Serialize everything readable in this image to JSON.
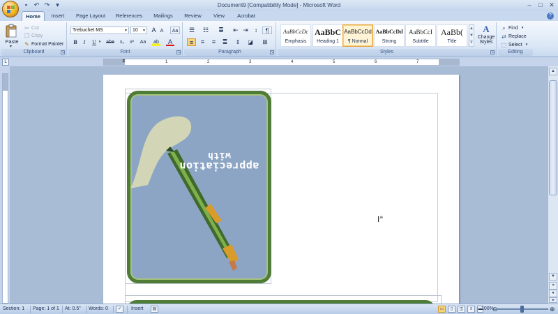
{
  "window": {
    "title": "Document9 [Compatibility Mode] - Microsoft Word",
    "controls": [
      "minimize",
      "maximize",
      "close"
    ]
  },
  "quick_access": [
    "save-icon",
    "undo-icon",
    "redo-icon",
    "customize-icon"
  ],
  "tabs": [
    "Home",
    "Insert",
    "Page Layout",
    "References",
    "Mailings",
    "Review",
    "View",
    "Acrobat"
  ],
  "active_tab": "Home",
  "ribbon": {
    "clipboard": {
      "label": "Clipboard",
      "paste": "Paste",
      "cut": "Cut",
      "copy": "Copy",
      "format_painter": "Format Painter"
    },
    "font": {
      "label": "Font",
      "font_name": "Trebuchet MS",
      "font_size": "10",
      "grow": "A",
      "shrink": "A",
      "clear": "Aa",
      "bold": "B",
      "italic": "I",
      "underline": "U",
      "strikethrough": "abe",
      "subscript": "x₂",
      "superscript": "x²",
      "change_case": "Aa",
      "highlight": "ab",
      "font_color": "A"
    },
    "paragraph": {
      "label": "Paragraph"
    },
    "styles": {
      "label": "Styles",
      "items": [
        {
          "preview": "AaBbCcDc",
          "name": "Emphasis"
        },
        {
          "preview": "AaBbC",
          "name": "Heading 1"
        },
        {
          "preview": "AaBbCcDd",
          "name": "¶ Normal"
        },
        {
          "preview": "AaBbCcDd",
          "name": "Strong"
        },
        {
          "preview": "AaBbCcI",
          "name": "Subtitle"
        },
        {
          "preview": "AaBb(",
          "name": "Title"
        }
      ],
      "selected": "¶ Normal",
      "change_styles_line1": "Change",
      "change_styles_line2": "Styles"
    },
    "editing": {
      "label": "Editing",
      "find": "Find",
      "replace": "Replace",
      "select": "Select"
    }
  },
  "ruler": {
    "ticks": [
      "1",
      "1",
      "2",
      "3",
      "4",
      "5",
      "6",
      "7"
    ]
  },
  "document": {
    "card_line1": "with",
    "card_line2": "appreciation"
  },
  "statusbar": {
    "section": "Section: 1",
    "page": "Page: 1 of 1",
    "at": "At: 0.5\"",
    "words": "Words: 0",
    "mode": "Insert",
    "zoom": "100%"
  },
  "colors": {
    "card_fill": "#8ca5c5",
    "card_border": "#4f7c36",
    "ribbon_accent": "#e6a23a"
  }
}
